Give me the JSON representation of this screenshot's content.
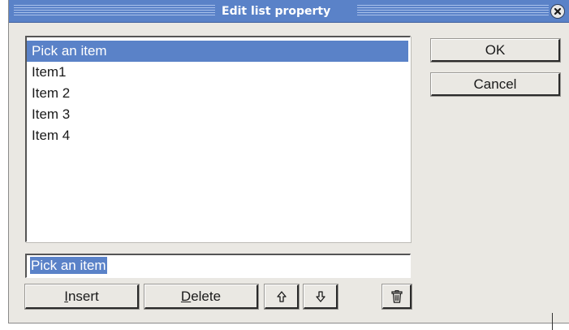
{
  "dialog": {
    "title": "Edit list property"
  },
  "list": {
    "items": [
      "Pick an item",
      "Item1",
      "Item 2",
      "Item 3",
      "Item 4"
    ],
    "selected_index": 0
  },
  "edit_field": {
    "value": "Pick an item"
  },
  "buttons": {
    "ok": "OK",
    "cancel": "Cancel",
    "insert_mnemonic": "I",
    "insert_rest": "nsert",
    "delete_mnemonic": "D",
    "delete_rest": "elete"
  },
  "icons": {
    "close": "close-icon",
    "move_up": "arrow-up-icon",
    "move_down": "arrow-down-icon",
    "trash": "trash-icon"
  },
  "colors": {
    "title_bar": "#5a82c8",
    "selection": "#5a82c8",
    "dialog_bg": "#eae8e3"
  }
}
